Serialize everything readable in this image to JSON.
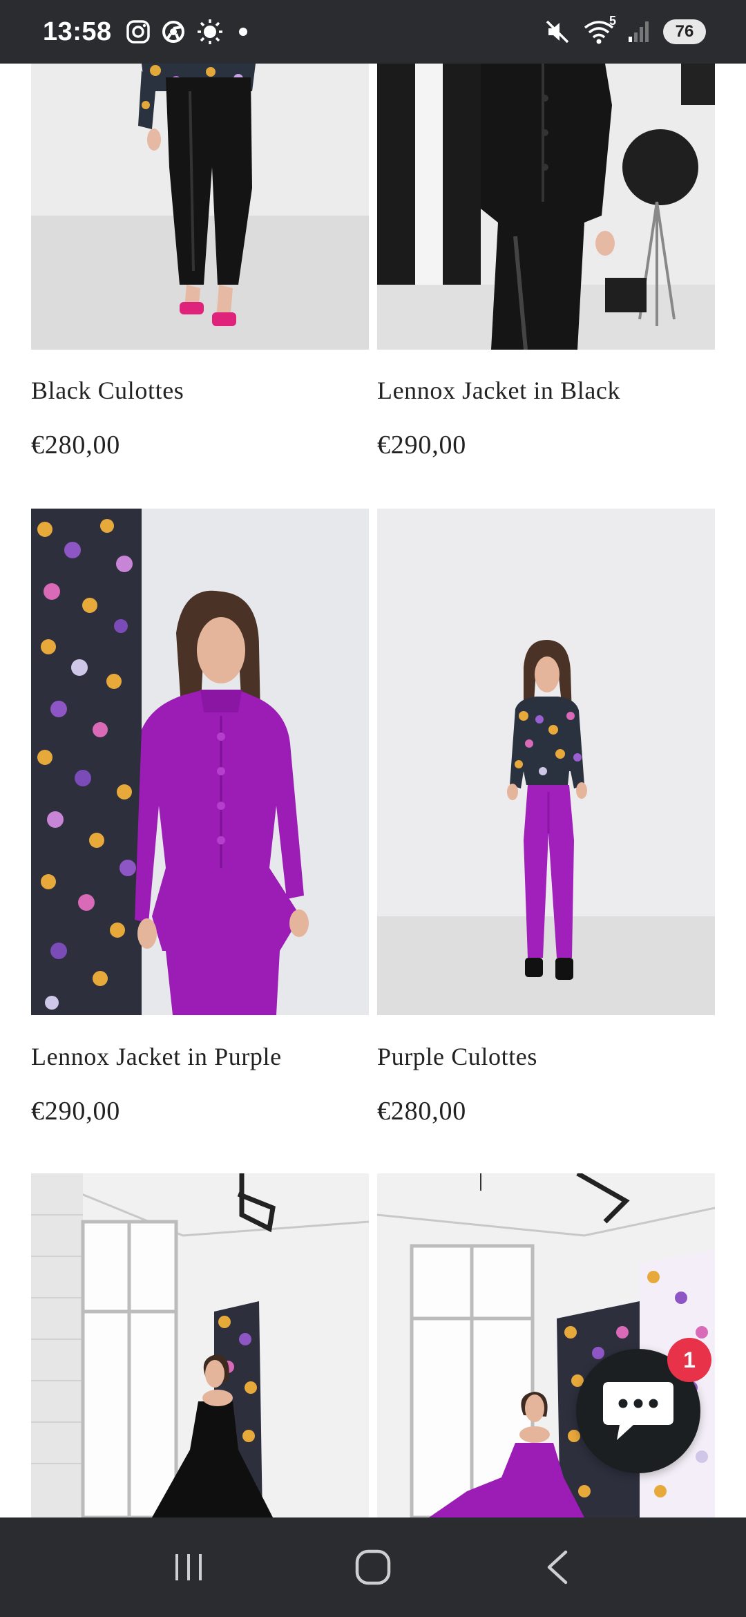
{
  "status_bar": {
    "time": "13:58",
    "battery": "76",
    "left_icons": [
      "instagram-icon",
      "chrome-icon",
      "brightness-icon",
      "dot-icon"
    ],
    "right_icons": [
      "mute-icon",
      "wifi-icon",
      "signal-icon"
    ],
    "wifi_label": "5"
  },
  "products": [
    {
      "name": "Black Culottes",
      "price": "€280,00"
    },
    {
      "name": "Lennox Jacket in Black",
      "price": "€290,00"
    },
    {
      "name": "Lennox Jacket in Purple",
      "price": "€290,00"
    },
    {
      "name": "Purple Culottes",
      "price": "€280,00"
    },
    {
      "name": "",
      "price": ""
    },
    {
      "name": "",
      "price": ""
    }
  ],
  "chat": {
    "badge_count": "1",
    "icon": "chat-bubble-icon"
  },
  "nav_bar": {
    "buttons": [
      "recent-apps-icon",
      "home-icon",
      "back-icon"
    ]
  },
  "colors": {
    "system_bar": "#2b2c30",
    "purple_garment": "#9b1db5",
    "badge": "#e8324a"
  }
}
